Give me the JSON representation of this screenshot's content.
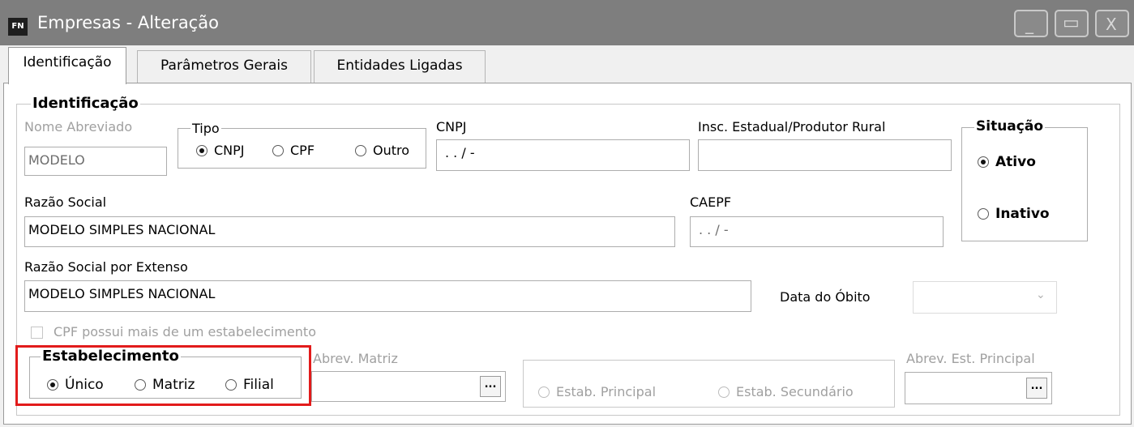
{
  "window": {
    "icon_text": "FN",
    "title": "Empresas - Alteração",
    "controls": {
      "minimize": "_",
      "maximize": "▭",
      "close": "X"
    }
  },
  "tabs": [
    {
      "label": "Identificação",
      "active": true
    },
    {
      "label": "Parâmetros Gerais",
      "active": false
    },
    {
      "label": "Entidades Ligadas",
      "active": false
    }
  ],
  "identificacao": {
    "group_title": "Identificação",
    "nome_abreviado": {
      "label": "Nome Abreviado",
      "value": "MODELO"
    },
    "tipo": {
      "group_title": "Tipo",
      "options": [
        {
          "label": "CNPJ",
          "selected": true
        },
        {
          "label": "CPF",
          "selected": false
        },
        {
          "label": "Outro",
          "selected": false
        }
      ]
    },
    "cnpj": {
      "label": "CNPJ",
      "value": " .  .  /  -"
    },
    "insc_estadual": {
      "label": "Insc. Estadual/Produtor Rural",
      "value": ""
    },
    "situacao": {
      "group_title": "Situação",
      "options": [
        {
          "label": "Ativo",
          "selected": true
        },
        {
          "label": "Inativo",
          "selected": false
        }
      ]
    },
    "razao_social": {
      "label": "Razão Social",
      "value": "MODELO SIMPLES NACIONAL"
    },
    "caepf": {
      "label": "CAEPF",
      "value": " .  .  /  -"
    },
    "razao_social_extenso": {
      "label": "Razão Social por Extenso",
      "value": "MODELO SIMPLES NACIONAL"
    },
    "data_obito": {
      "label": "Data do Óbito",
      "value": ""
    },
    "cpf_multi": {
      "label": "CPF possui mais de um estabelecimento",
      "checked": false
    },
    "estabelecimento": {
      "group_title": "Estabelecimento",
      "options": [
        {
          "label": "Único",
          "selected": true
        },
        {
          "label": "Matriz",
          "selected": false
        },
        {
          "label": "Filial",
          "selected": false
        }
      ]
    },
    "abrev_matriz": {
      "label": "Abrev. Matriz",
      "value": "",
      "button": "..."
    },
    "estab_tipo": {
      "options": [
        {
          "label": "Estab. Principal",
          "selected": false
        },
        {
          "label": "Estab. Secundário",
          "selected": false
        }
      ]
    },
    "abrev_est_principal": {
      "label": "Abrev. Est. Principal",
      "value": "",
      "button": "..."
    }
  },
  "colors": {
    "titlebar": "#7e7e7e",
    "highlight": "#e21b1b",
    "disabled_text": "#a0a0a0"
  }
}
